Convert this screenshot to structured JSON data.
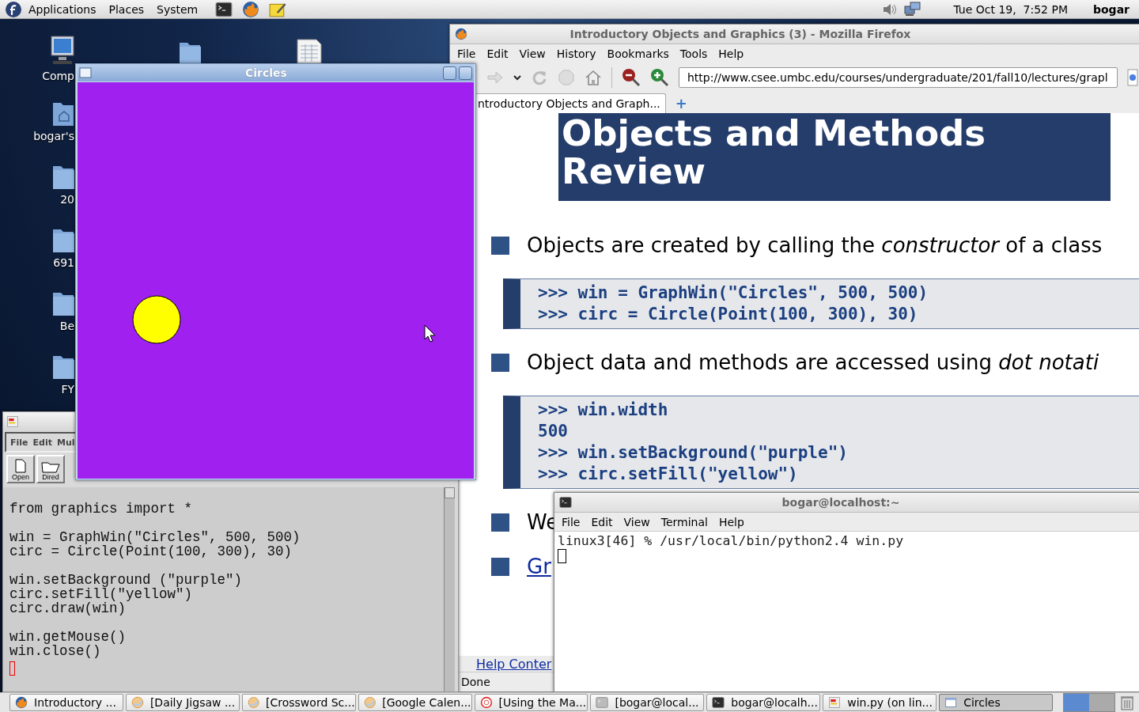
{
  "top_panel": {
    "menus": [
      "Applications",
      "Places",
      "System"
    ],
    "launchers": [
      {
        "kind": "terminal"
      },
      {
        "kind": "firefox"
      },
      {
        "kind": "notes"
      }
    ],
    "clock": "Tue Oct 19,  7:52 PM",
    "user": "bogar"
  },
  "desktop_icons": [
    {
      "label": "Comp",
      "kind": "computer"
    },
    {
      "label": "bogar's",
      "kind": "home"
    },
    {
      "label": "20",
      "kind": "folder"
    },
    {
      "label": "691",
      "kind": "folder"
    },
    {
      "label": "Be",
      "kind": "folder"
    },
    {
      "label": "FY",
      "kind": "folder"
    }
  ],
  "desktop_top_icons": [
    {
      "kind": "folder"
    },
    {
      "kind": "spreadsheet"
    }
  ],
  "firefox": {
    "title": "Introductory Objects and Graphics (3) - Mozilla Firefox",
    "menu": [
      "File",
      "Edit",
      "View",
      "History",
      "Bookmarks",
      "Tools",
      "Help"
    ],
    "url": "http://www.csee.umbc.edu/courses/undergraduate/201/fall10/lectures/grapl",
    "tabs": [
      {
        "label": "ntroductory Objects and Graph...",
        "selected": true
      }
    ],
    "page": {
      "heading": "Objects and Methods Review",
      "blocks": [
        {
          "kind": "bullet",
          "text": "Objects are created by calling the *constructor* of a class"
        },
        {
          "kind": "code",
          "lines": [
            ">>> win = GraphWin(\"Circles\", 500, 500)",
            ">>> circ = Circle(Point(100, 300), 30)"
          ]
        },
        {
          "kind": "bullet",
          "text": "Object data and methods are accessed using *dot notati*"
        },
        {
          "kind": "code",
          "lines": [
            ">>> win.width",
            "500",
            ">>> win.setBackground(\"purple\")",
            ">>> circ.setFill(\"yellow\")"
          ]
        },
        {
          "kind": "bullet",
          "text": "We"
        },
        {
          "kind": "link",
          "text": "Gr"
        }
      ]
    },
    "new_tab": "+",
    "footer_link": "Help Conter",
    "status": "Done"
  },
  "emacs": {
    "menu": [
      "File",
      "Edit",
      "Mul"
    ],
    "toolbar": [
      "Open",
      "Dired"
    ],
    "code": [
      [
        "from graphics import *"
      ],
      [
        "win = GraphWin(\"Circles\", 500, 500)",
        "circ = Circle(Point(100, 300), 30)"
      ],
      [
        "win.setBackground (\"purple\")",
        "circ.setFill(\"yellow\")",
        "circ.draw(win)"
      ],
      [
        "win.getMouse()",
        "win.close()"
      ]
    ]
  },
  "circles_window": {
    "title": "Circles"
  },
  "terminal": {
    "title": "bogar@localhost:~",
    "menu": [
      "File",
      "Edit",
      "View",
      "Terminal",
      "Help"
    ],
    "lines": [
      "linux3[46] % /usr/local/bin/python2.4 win.py"
    ]
  },
  "taskbar": [
    {
      "label": "Introductory ...",
      "kind": "firefox",
      "selected": false
    },
    {
      "label": "[Daily Jigsaw ...",
      "kind": "web",
      "selected": false
    },
    {
      "label": "[Crossword Sc...",
      "kind": "web",
      "selected": false
    },
    {
      "label": "[Google Calen...",
      "kind": "web",
      "selected": false
    },
    {
      "label": "[Using the Ma...",
      "kind": "help",
      "selected": false
    },
    {
      "label": "[bogar@local...",
      "kind": "terminal-dim",
      "selected": false
    },
    {
      "label": "bogar@localh...",
      "kind": "terminal",
      "selected": false
    },
    {
      "label": "win.py (on lin...",
      "kind": "emacs",
      "selected": false
    },
    {
      "label": "Circles",
      "kind": "window",
      "selected": true
    }
  ]
}
